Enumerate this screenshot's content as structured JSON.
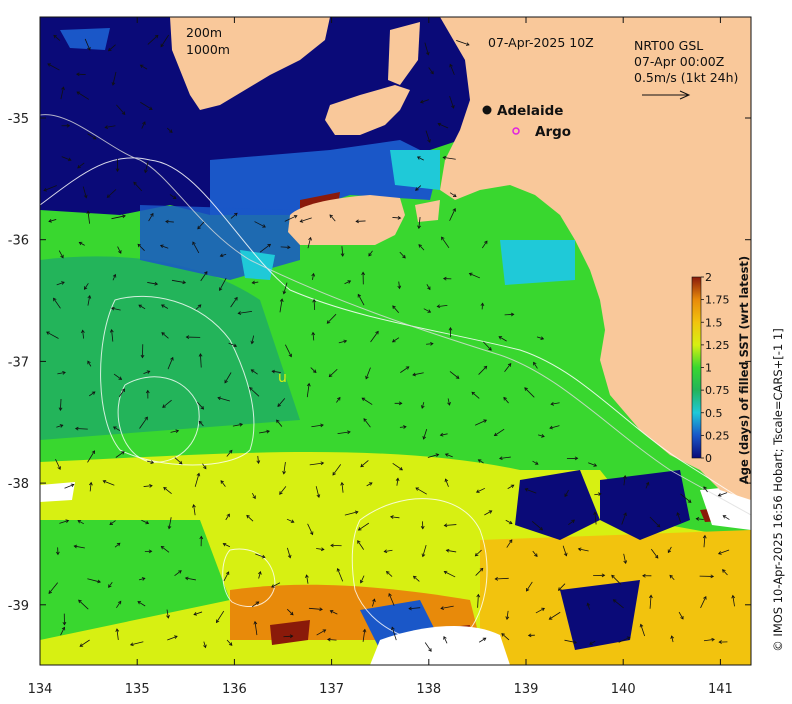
{
  "map": {
    "date_title": "07-Apr-2025 10Z",
    "product": {
      "line1": "NRT00 GSL",
      "line2": "07-Apr 00:00Z",
      "line3": "0.5m/s (1kt 24h)"
    },
    "depth_labels": [
      "200m",
      "1000m"
    ],
    "places": [
      {
        "name": "Adelaide",
        "marker": "filled-dot",
        "color": "#111111"
      },
      {
        "name": "Argo",
        "marker": "open-circle",
        "color": "#e020e0"
      }
    ],
    "x_ticks": [
      "134",
      "135",
      "136",
      "137",
      "138",
      "139",
      "140",
      "141"
    ],
    "y_ticks": [
      "-35",
      "-36",
      "-37",
      "-38",
      "-39"
    ],
    "colorbar": {
      "label": "Age (days) of filled SST (wrt latest)",
      "ticks": [
        "2",
        "1.75",
        "1.5",
        "1.25",
        "1",
        "0.75",
        "0.5",
        "0.25",
        "0"
      ]
    },
    "credit": "© IMOS 10-Apr-2025 16:56 Hobart; Tscale=CARS+[-1 1]",
    "colors": {
      "land": "#f9c89a",
      "age_0": "#0a0a78",
      "age_025": "#1a57c8",
      "age_05": "#1fc9d8",
      "age_075": "#23b45a",
      "age_1": "#39d72f",
      "age_125": "#d7f012",
      "age_15": "#f2c30e",
      "age_175": "#e88a0a",
      "age_2": "#8a1a0a"
    }
  }
}
